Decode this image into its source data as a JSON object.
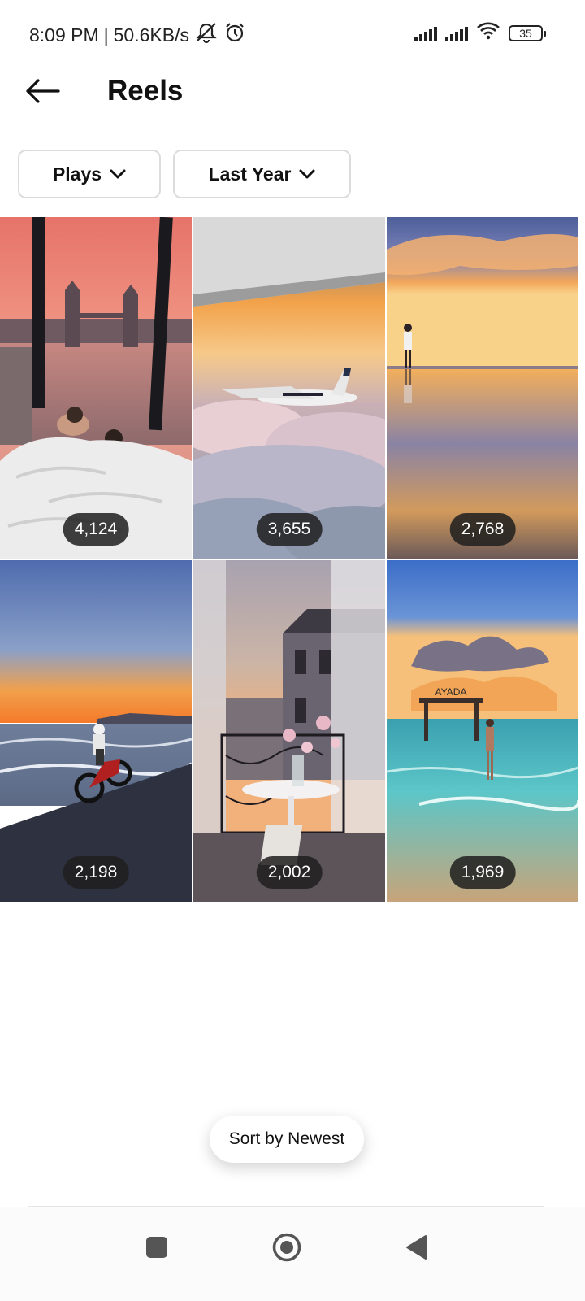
{
  "status_bar": {
    "time": "8:09 PM",
    "separator": "|",
    "speed": "50.6KB/s",
    "battery": "35",
    "icons": [
      "mute-icon",
      "alarm-icon",
      "signal-icon",
      "signal-icon",
      "wifi-icon",
      "battery-icon"
    ]
  },
  "header": {
    "title": "Reels",
    "back_icon": "arrow-left-icon"
  },
  "filters": {
    "metric": "Plays",
    "period": "Last Year",
    "chevron_icon": "chevron-down-icon"
  },
  "reels": [
    {
      "plays": "4,124"
    },
    {
      "plays": "3,655"
    },
    {
      "plays": "2,768"
    },
    {
      "plays": "2,198"
    },
    {
      "plays": "2,002"
    },
    {
      "plays": "1,969"
    }
  ],
  "reel_sign_text": "AYADA",
  "sort_button": "Sort by Newest",
  "nav": {
    "recents_icon": "square-icon",
    "home_icon": "circle-icon",
    "back_icon": "triangle-back-icon"
  },
  "colors": {
    "accent_text": "#111111",
    "count_badge": "#1e1e1e",
    "filter_border": "#dcdcdc"
  }
}
